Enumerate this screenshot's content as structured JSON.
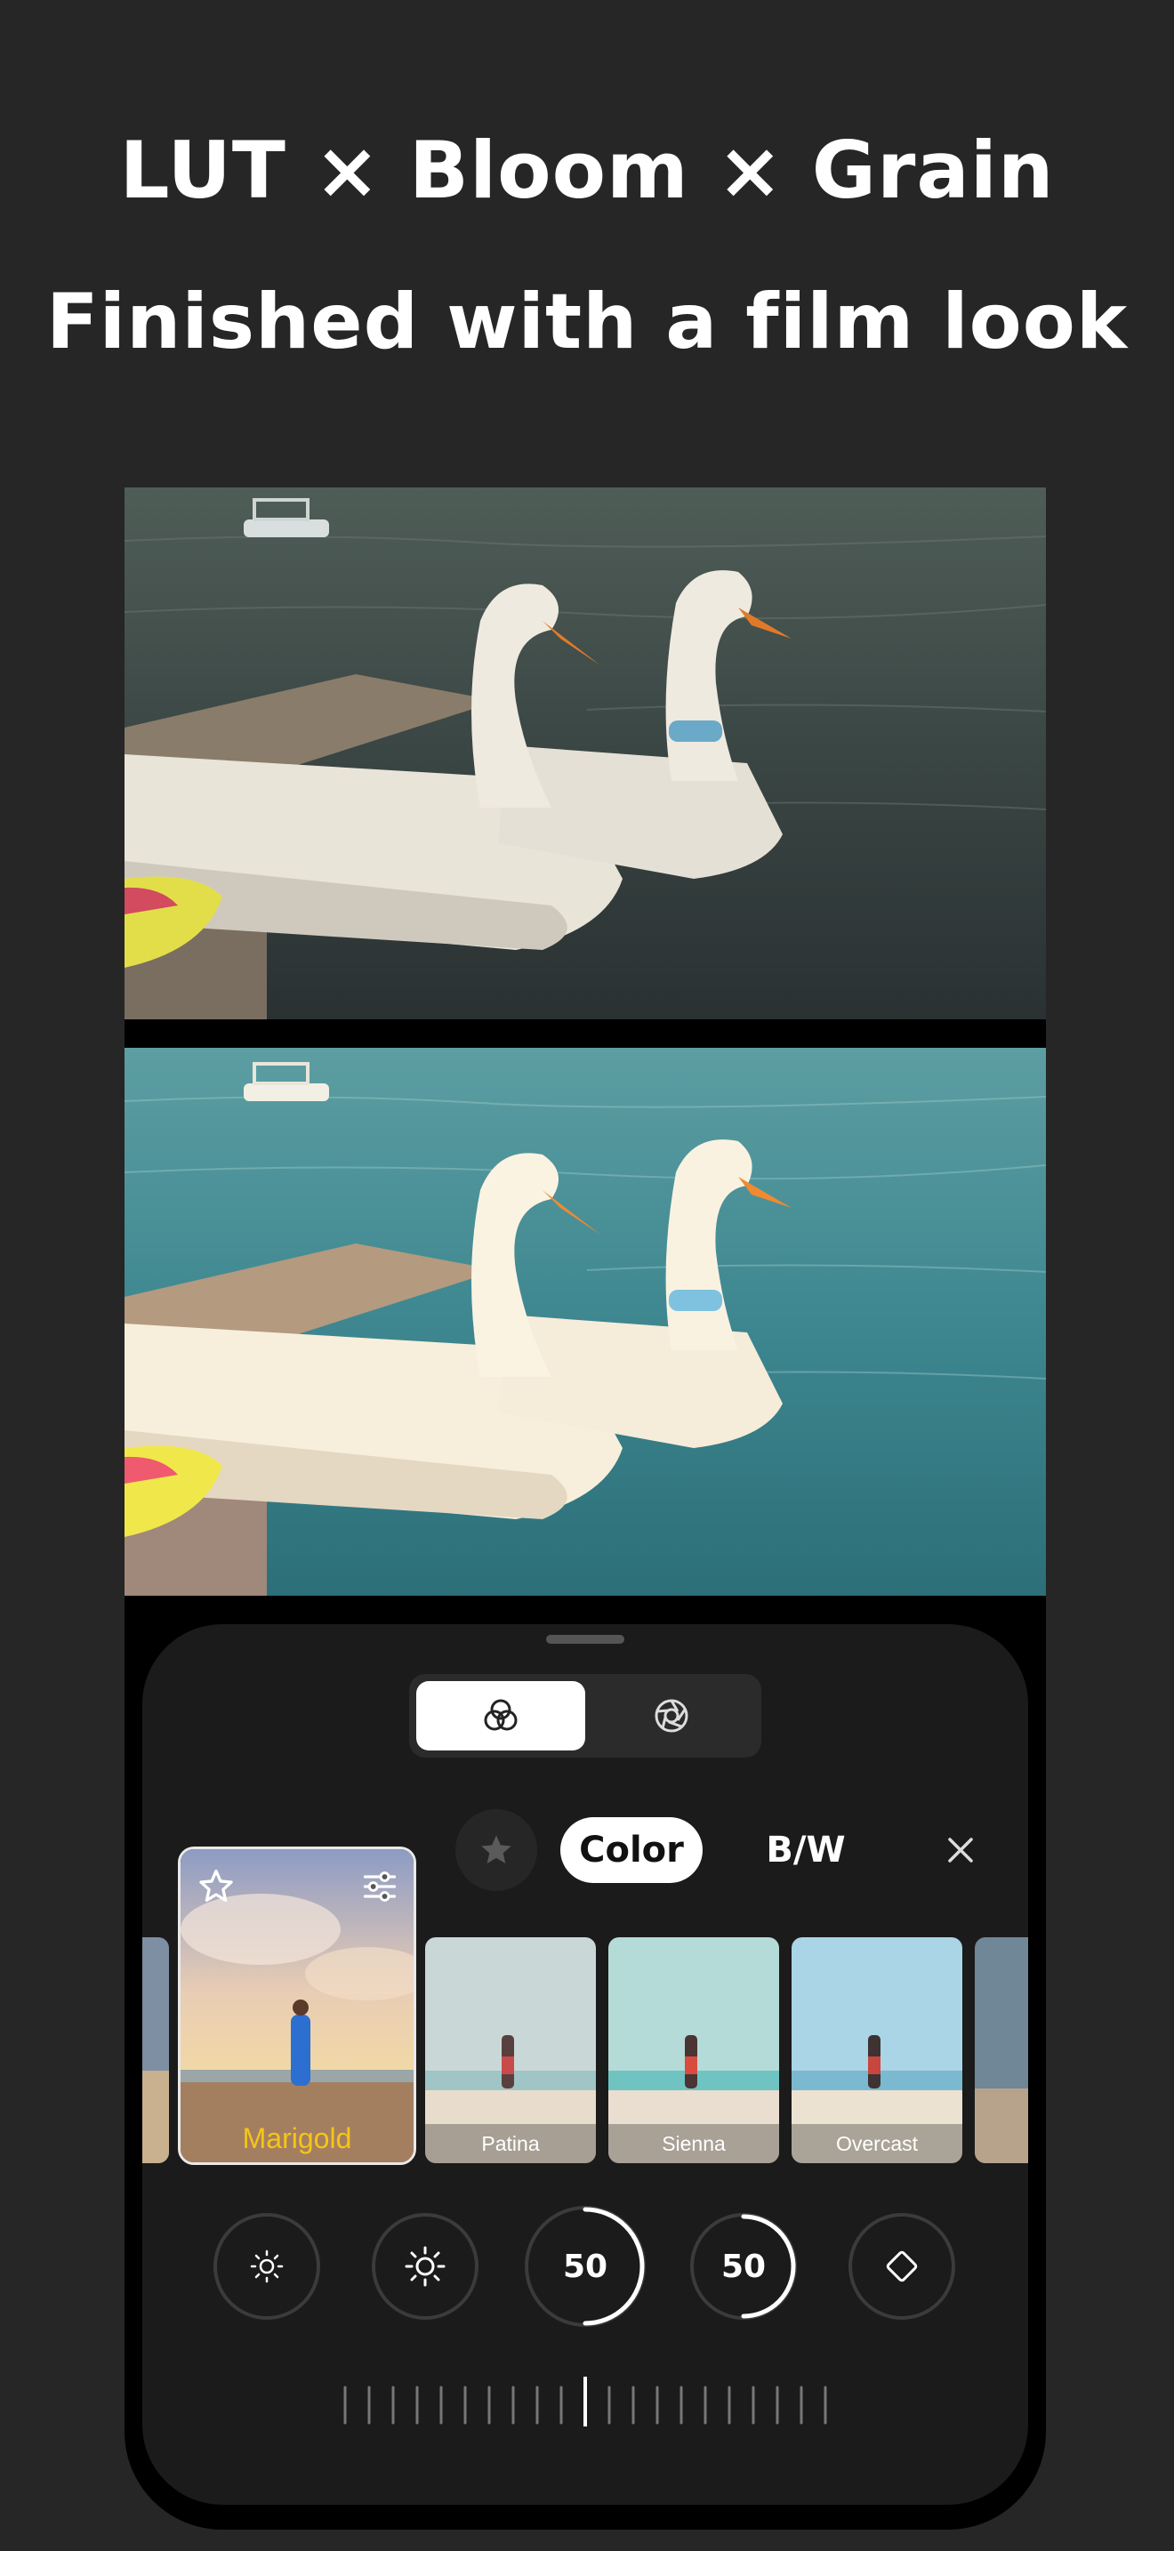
{
  "headline": {
    "line1": "LUT × Bloom × Grain",
    "line2": "Finished with a film look"
  },
  "editor": {
    "mode_tabs": [
      {
        "name": "filters-tab",
        "icon": "color-circles-icon",
        "selected": true
      },
      {
        "name": "effects-tab",
        "icon": "aperture-icon",
        "selected": false
      }
    ],
    "categories": {
      "favorites_icon": "star-icon",
      "color_label": "Color",
      "bw_label": "B/W",
      "close_icon": "close-icon",
      "selected": "Color"
    },
    "filters": {
      "selected": "Marigold",
      "items": [
        "Patina",
        "Sienna",
        "Overcast"
      ]
    },
    "controls": [
      {
        "name": "brightness-control",
        "icon": "sun-small-icon",
        "value": ""
      },
      {
        "name": "exposure-control",
        "icon": "sun-large-icon",
        "value": ""
      },
      {
        "name": "bloom-control",
        "value": "50",
        "level": 0.5
      },
      {
        "name": "grain-control",
        "value": "50",
        "level": 0.5
      },
      {
        "name": "shape-control",
        "icon": "diamond-icon",
        "value": ""
      }
    ]
  },
  "colors": {
    "background": "#262626",
    "panel": "#1b1b1b",
    "accent_label": "#f5c518"
  }
}
